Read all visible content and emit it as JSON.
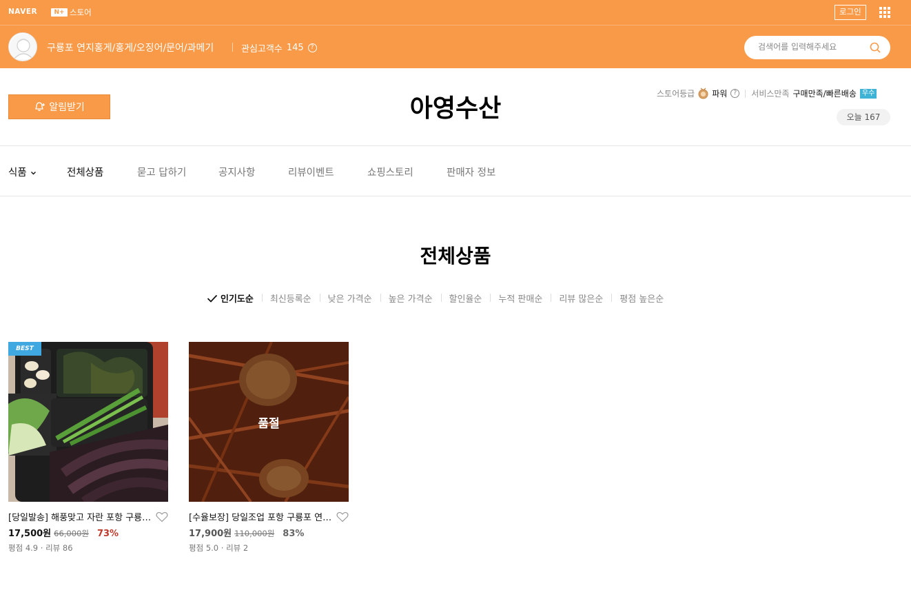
{
  "gnb": {
    "naver": "NAVER",
    "nplus_box": "N+",
    "nplus_label": "스토어",
    "login": "로그인"
  },
  "store": {
    "name": "구룡포 연지홍게/홍게/오징어/문어/과메기",
    "interest_label": "관심고객수",
    "interest_count": "145",
    "search_placeholder": "검색어를 입력해주세요",
    "title": "아영수산",
    "alarm_label": "알림받기",
    "grade_label": "스토어등급",
    "grade_value": "파워",
    "service_label": "서비스만족",
    "service_value": "구매만족/빠른배송",
    "service_badge": "우수",
    "today_label": "오늘",
    "today_count": "167"
  },
  "nav": {
    "items": [
      "식품",
      "전체상품",
      "묻고 답하기",
      "공지사항",
      "리뷰이벤트",
      "쇼핑스토리",
      "판매자 정보"
    ]
  },
  "section": {
    "title": "전체상품",
    "sorts": [
      "인기도순",
      "최신등록순",
      "낮은 가격순",
      "높은 가격순",
      "할인율순",
      "누적 판매순",
      "리뷰 많은순",
      "평점 높은순"
    ]
  },
  "products": [
    {
      "badge": "BEST",
      "name": "[당일발송] 해풍맞고 자란 포항 구룡포 과메기",
      "price": "17,500원",
      "original": "66,000원",
      "discount": "73%",
      "meta": "평점 4.9 · 리뷰 86"
    },
    {
      "soldout": "품절",
      "name": "[수율보장] 당일조업 포항 구룡포 연지홍게",
      "price": "17,900원",
      "original": "110,000원",
      "discount": "83%",
      "meta": "평점 5.0 · 리뷰 2"
    }
  ],
  "colors": {
    "brand_orange": "#f89a48",
    "badge_blue": "#3fb3d6",
    "discount_red": "#c0392b"
  }
}
